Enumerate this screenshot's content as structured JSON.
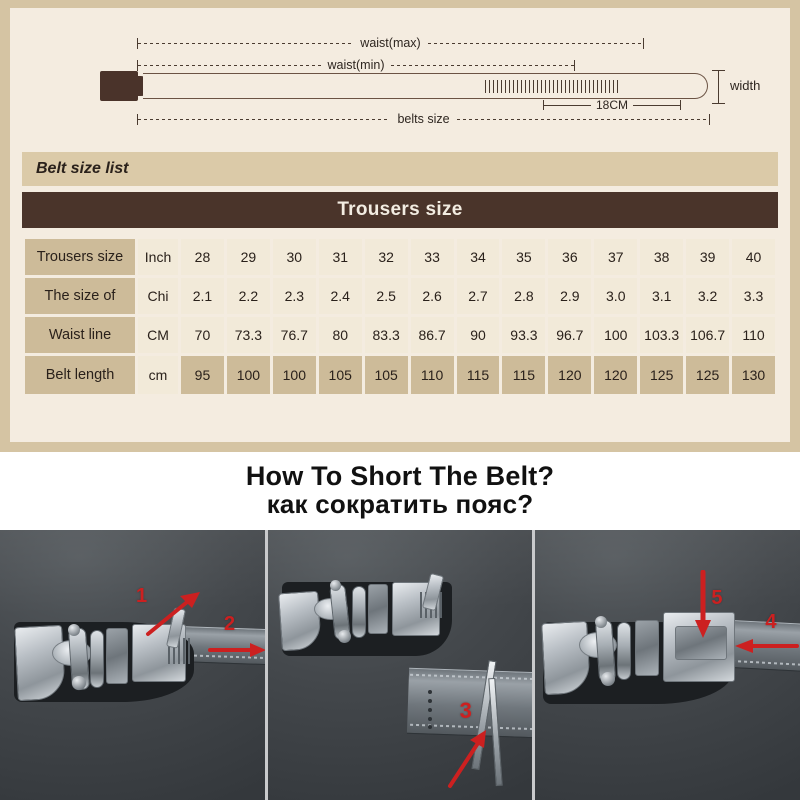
{
  "diagram": {
    "waist_max_label": "waist(max)",
    "waist_min_label": "waist(min)",
    "belts_size_label": "belts size",
    "tip_length_label": "18CM",
    "width_label": "width"
  },
  "size_list_header": "Belt size list",
  "table_title": "Trousers size",
  "table": {
    "rows": [
      {
        "label": "Trousers size",
        "unit": "Inch",
        "values": [
          "28",
          "29",
          "30",
          "31",
          "32",
          "33",
          "34",
          "35",
          "36",
          "37",
          "38",
          "39",
          "40"
        ]
      },
      {
        "label": "The size of",
        "unit": "Chi",
        "values": [
          "2.1",
          "2.2",
          "2.3",
          "2.4",
          "2.5",
          "2.6",
          "2.7",
          "2.8",
          "2.9",
          "3.0",
          "3.1",
          "3.2",
          "3.3"
        ]
      },
      {
        "label": "Waist line",
        "unit": "CM",
        "values": [
          "70",
          "73.3",
          "76.7",
          "80",
          "83.3",
          "86.7",
          "90",
          "93.3",
          "96.7",
          "100",
          "103.3",
          "106.7",
          "110"
        ]
      },
      {
        "label": "Belt length",
        "unit": "cm",
        "values": [
          "95",
          "100",
          "100",
          "105",
          "105",
          "110",
          "115",
          "115",
          "120",
          "120",
          "125",
          "125",
          "130"
        ]
      }
    ]
  },
  "howto": {
    "line1": "How To Short The Belt?",
    "line2": "как сократить пояс?"
  },
  "photos": [
    {
      "annotations": [
        "1",
        "2"
      ]
    },
    {
      "annotations": [
        "3"
      ]
    },
    {
      "annotations": [
        "5",
        "4"
      ]
    }
  ],
  "colors": {
    "card_border": "#d5c4a3",
    "card_bg": "#f4ece0",
    "list_bar": "#dbcaa8",
    "dark_bar": "#4a342a",
    "cell_light": "#f2ead9",
    "cell_tan": "#cdbb99",
    "buckle_brown": "#4a332a",
    "arrow_red": "#cc2020"
  }
}
